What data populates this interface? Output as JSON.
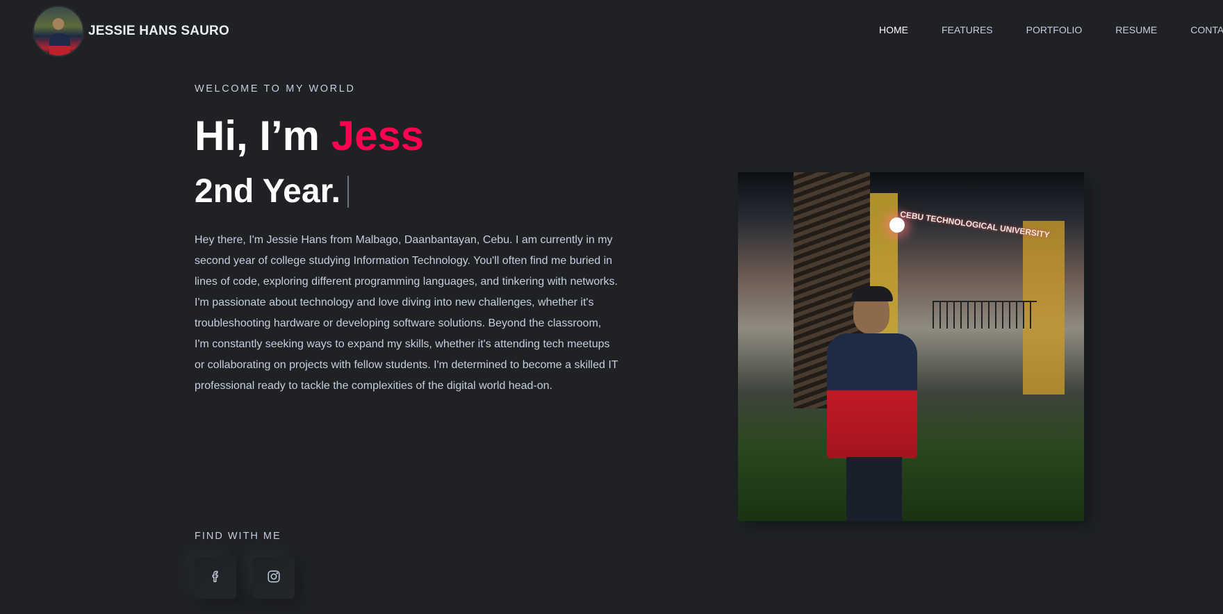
{
  "brand": {
    "name": "JESSIE HANS SAURO"
  },
  "nav": {
    "items": [
      {
        "label": "HOME"
      },
      {
        "label": "FEATURES"
      },
      {
        "label": "PORTFOLIO"
      },
      {
        "label": "RESUME"
      },
      {
        "label": "CONTACT"
      }
    ]
  },
  "hero": {
    "eyebrow": "WELCOME TO MY WORLD",
    "title_prefix": "Hi, I’m ",
    "title_name": "Jess",
    "subtitle": "2nd Year.",
    "description": "Hey there, I'm Jessie Hans from Malbago, Daanbantayan, Cebu. I am currently in my second year of college studying Information Technology. You'll often find me buried in lines of code, exploring different programming languages, and tinkering with networks. I'm passionate about technology and love diving into new challenges, whether it's troubleshooting hardware or developing software solutions. Beyond the classroom, I'm constantly seeking ways to expand my skills, whether it's attending tech meetups or collaborating on projects with fellow students. I'm determined to become a skilled IT professional ready to tackle the complexities of the digital world head-on."
  },
  "find": {
    "title": "FIND WITH ME",
    "socials": [
      {
        "icon": "facebook-icon"
      },
      {
        "icon": "instagram-icon"
      }
    ]
  },
  "photo": {
    "sign_text": "CEBU TECHNOLOGICAL UNIVERSITY"
  },
  "colors": {
    "background": "#1f2125",
    "accent": "#ff014f",
    "text": "#c4cfde",
    "heading": "#ffffff"
  }
}
